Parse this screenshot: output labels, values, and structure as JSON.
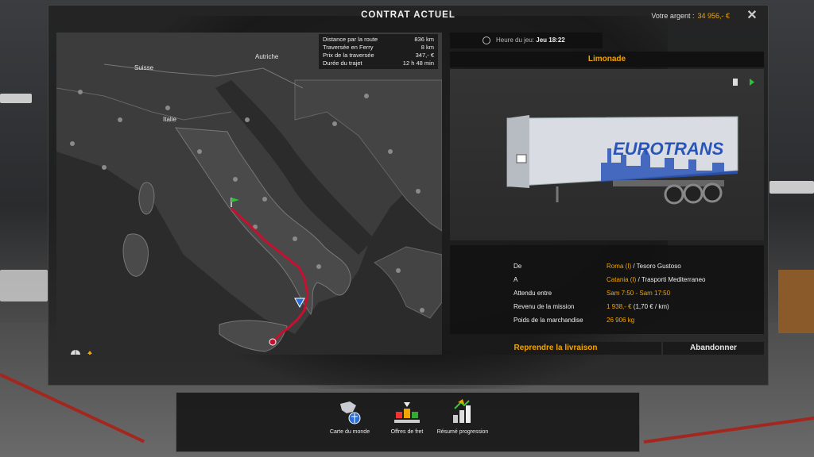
{
  "window": {
    "title": "CONTRAT ACTUEL",
    "money_label": "Votre argent :",
    "money_value": "34 956,- €"
  },
  "map": {
    "labels": {
      "suisse": "Suisse",
      "autriche": "Autriche",
      "italie": "Italie"
    },
    "route_info": [
      {
        "label": "Distance par la route",
        "value": "836 km"
      },
      {
        "label": "Traversée en Ferry",
        "value": "8 km"
      },
      {
        "label": "Prix de la traversée",
        "value": "347,- €"
      },
      {
        "label": "Durée du trajet",
        "value": "12 h 48 min"
      }
    ]
  },
  "time": {
    "label": "Heure du jeu:",
    "value": "Jeu 18:22"
  },
  "cargo": {
    "name": "Limonade",
    "trailer_brand": "EUROTRANS"
  },
  "details": {
    "from_label": "De",
    "from_city": "Roma (I)",
    "from_company": " / Tesoro Gustoso",
    "to_label": "A",
    "to_city": "Catania (I)",
    "to_company": " / Trasporti Mediterraneo",
    "expected_label": "Attendu entre",
    "expected_value": "Sam 7:50 - Sam 17:50",
    "revenue_label": "Revenu de la mission",
    "revenue_value": "1 938,- €",
    "revenue_rate": " (1,70 € / km)",
    "weight_label": "Poids de la marchandise",
    "weight_value": "26 906 kg"
  },
  "buttons": {
    "resume": "Reprendre la livraison",
    "abandon": "Abandonner"
  },
  "taskbar": [
    {
      "label": "Carte du monde",
      "icon": "world-map-icon"
    },
    {
      "label": "Offres de fret",
      "icon": "freight-offers-icon"
    },
    {
      "label": "Résumé progression",
      "icon": "progression-icon"
    }
  ],
  "colors": {
    "accent": "#f0a500",
    "route": "#c8102e"
  }
}
